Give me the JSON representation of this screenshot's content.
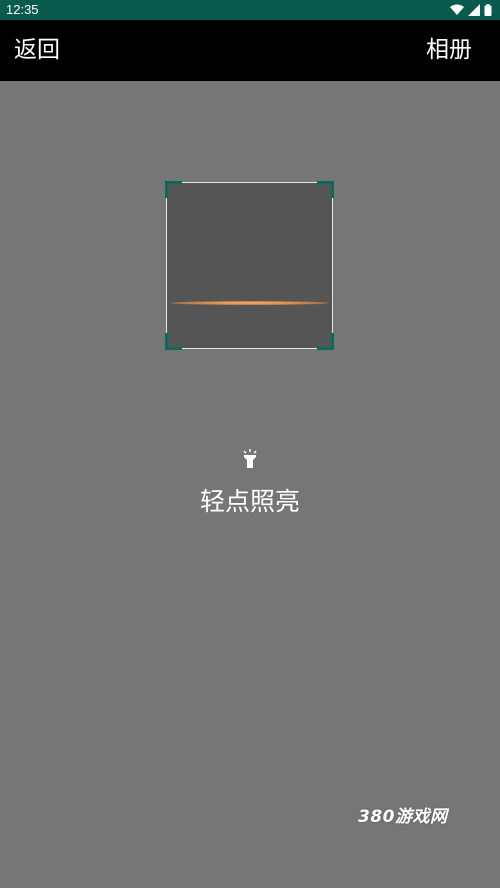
{
  "status_bar": {
    "time": "12:35",
    "icons": [
      "wifi-icon",
      "signal-icon",
      "battery-icon"
    ]
  },
  "app_bar": {
    "back_label": "返回",
    "album_label": "相册"
  },
  "scanner": {
    "torch_icon": "flashlight-icon",
    "torch_label": "轻点照亮"
  },
  "watermark": {
    "text": "380游戏网"
  },
  "colors": {
    "status_bar_bg": "#0b5a4e",
    "app_bar_bg": "#000000",
    "camera_bg": "#767676",
    "frame_corner": "#0c6a5c",
    "scan_line": "#d88b4c"
  }
}
